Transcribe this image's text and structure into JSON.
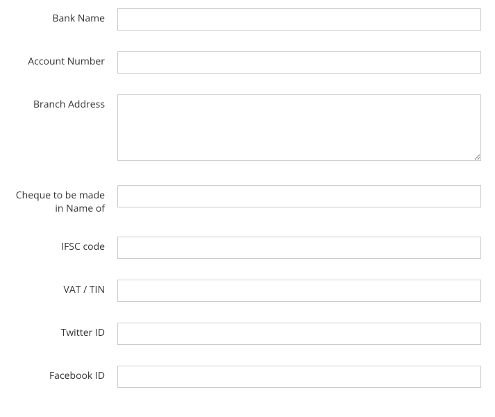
{
  "form": {
    "bank_name": {
      "label": "Bank Name",
      "value": ""
    },
    "account_number": {
      "label": "Account Number",
      "value": ""
    },
    "branch_address": {
      "label": "Branch Address",
      "value": ""
    },
    "cheque_name": {
      "label": "Cheque to be made in Name of",
      "value": ""
    },
    "ifsc_code": {
      "label": "IFSC code",
      "value": ""
    },
    "vat_tin": {
      "label": "VAT / TIN",
      "value": ""
    },
    "twitter_id": {
      "label": "Twitter ID",
      "value": ""
    },
    "facebook_id": {
      "label": "Facebook ID",
      "value": ""
    }
  }
}
